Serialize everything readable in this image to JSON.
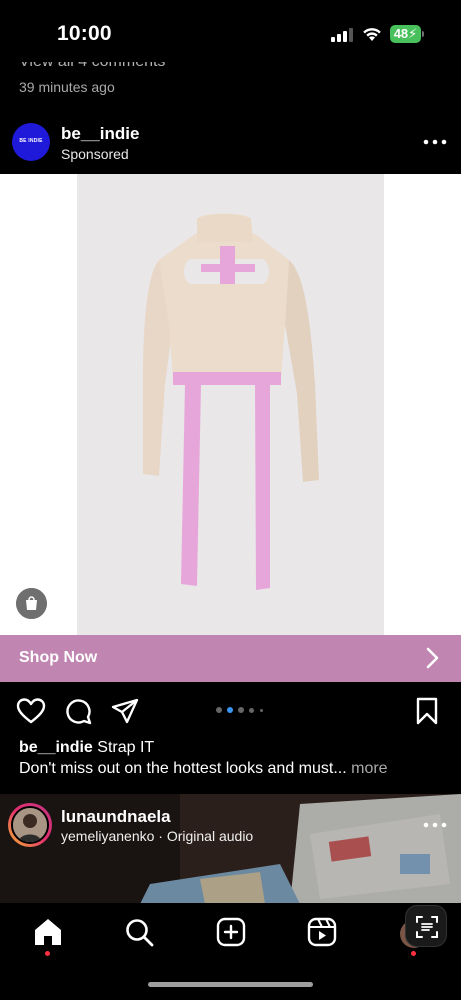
{
  "status_bar": {
    "time": "10:00",
    "battery": "48",
    "icons": [
      "signal-icon",
      "wifi-icon",
      "battery-charging-icon"
    ]
  },
  "previous_post": {
    "comments_link": "View all 4 comments",
    "time_ago": "39 minutes ago"
  },
  "post": {
    "username": "be__indie",
    "label": "Sponsored",
    "avatar_text": "BE INDIE",
    "cta": "Shop Now",
    "caption_user": "be__indie",
    "caption_title": "Strap IT",
    "caption_text": "Don't miss out on the hottest looks and must...",
    "caption_more": "more",
    "carousel": {
      "count": 5,
      "active_index": 1
    },
    "colors": {
      "cta_bg": "#c086b1",
      "sweater": "#ead9c8",
      "straps": "#e7a6da"
    }
  },
  "next_reel": {
    "username": "lunaundnaela",
    "audio": "yemeliyanenko · Original audio"
  },
  "tab_bar": {
    "items": [
      "home-icon",
      "search-icon",
      "create-icon",
      "reels-icon",
      "profile-avatar"
    ],
    "active": "home-icon",
    "accent": "#ff3040"
  }
}
